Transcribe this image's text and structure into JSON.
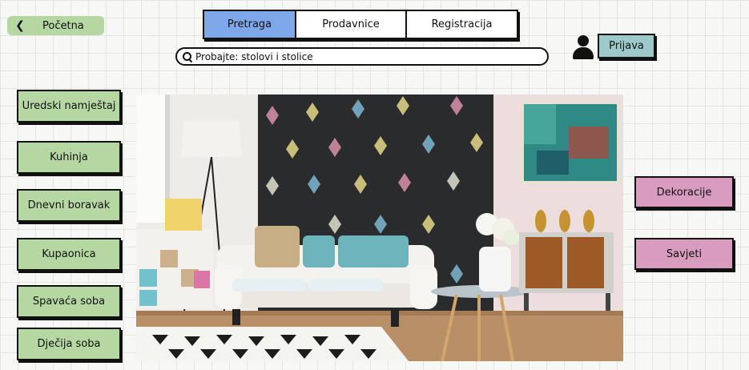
{
  "nav": {
    "back_label": "Početna",
    "tabs": [
      {
        "label": "Pretraga",
        "active": true
      },
      {
        "label": "Prodavnice",
        "active": false
      },
      {
        "label": "Registracija",
        "active": false
      }
    ]
  },
  "search": {
    "placeholder": "Probajte: stolovi i stolice",
    "value": ""
  },
  "account": {
    "login_label": "Prijava"
  },
  "categories_left": [
    "Uredski namještaj",
    "Kuhinja",
    "Dnevni boravak",
    "Kupaonica",
    "Spavaća soba",
    "Dječija soba"
  ],
  "categories_right": [
    "Dekoracije",
    "Savjeti"
  ],
  "colors": {
    "category_green": "#b5d7a2",
    "category_pink": "#d89cbe",
    "active_tab_blue": "#7fa8ea",
    "login_teal": "#9ec9cb"
  },
  "icons": [
    "chevron-left-icon",
    "search-icon",
    "user-icon"
  ]
}
